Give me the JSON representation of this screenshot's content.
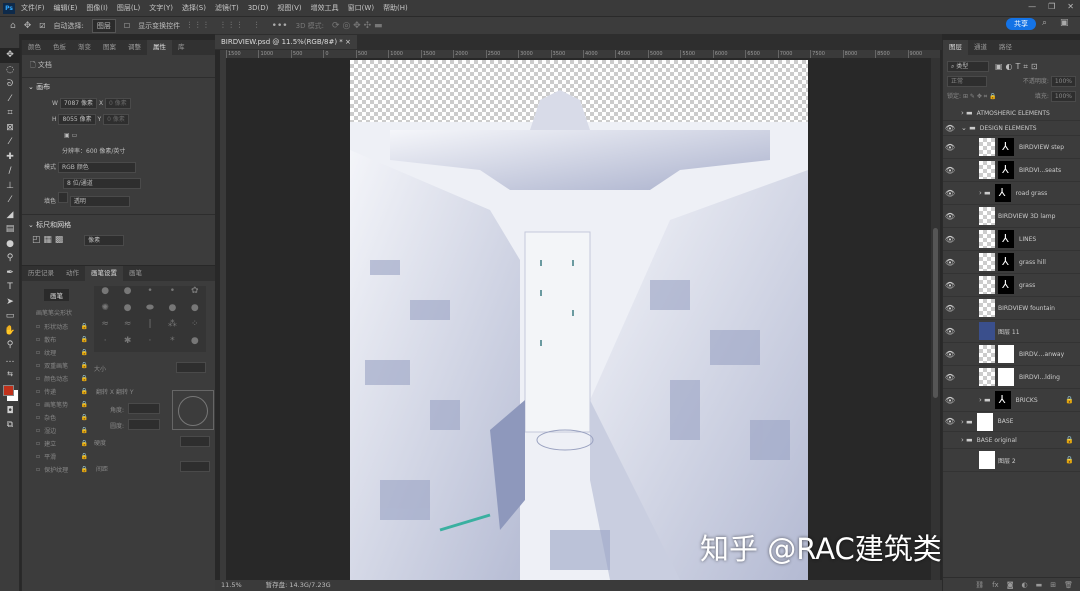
{
  "app": {
    "logo": "Ps"
  },
  "menu": [
    "文件(F)",
    "编辑(E)",
    "图像(I)",
    "图层(L)",
    "文字(Y)",
    "选择(S)",
    "滤镜(T)",
    "3D(D)",
    "视图(V)",
    "增效工具",
    "窗口(W)",
    "帮助(H)"
  ],
  "options": {
    "auto_select_label": "自动选择:",
    "auto_select_value": "图层",
    "show_transform_label": "显示变换控件",
    "mode_3d": "3D 模式:",
    "share": "共享"
  },
  "left_panel": {
    "tabs": [
      "颜色",
      "色板",
      "渐变",
      "图案",
      "调整",
      "属性",
      "库"
    ],
    "active_tab": "属性",
    "doc_label": "文档",
    "canvas_section": "画布",
    "w_label": "W",
    "w_value": "7087 像素",
    "x_label": "X",
    "h_label": "H",
    "h_value": "8055 像素",
    "y_label": "Y",
    "xy_placeholder": "0 像素",
    "resolution": "分辨率：600 像素/英寸",
    "mode_label": "模式",
    "mode_value": "RGB 颜色",
    "depth_value": "8 位/通道",
    "fill_label": "填色",
    "fill_value": "透明",
    "rulers_section": "标尺和网格",
    "grid_unit": "像素"
  },
  "brush_panel": {
    "tabs": [
      "历史记录",
      "动作",
      "画笔设置",
      "画笔"
    ],
    "active_tab": "画笔设置",
    "preset_button": "画笔",
    "tip_shape": "画笔笔尖形状",
    "options": [
      "形状动态",
      "散布",
      "纹理",
      "双重画笔",
      "颜色动态",
      "传递",
      "画笔笔势",
      "杂色",
      "湿边",
      "建立",
      "平滑",
      "保护纹理"
    ],
    "size_label": "大小",
    "flip_x": "翻转 X",
    "flip_y": "翻转 Y",
    "angle_label": "角度:",
    "roundness_label": "圆度:",
    "hardness_label": "硬度",
    "spacing_label": "间距"
  },
  "document": {
    "tab_title": "BIRDVIEW.psd @ 11.5%(RGB/8#) *",
    "ruler_ticks": [
      "1500",
      "1000",
      "500",
      "0",
      "500",
      "1000",
      "1500",
      "2000",
      "2500",
      "3000",
      "3500",
      "4000",
      "4500",
      "5000",
      "5500",
      "6000",
      "6500",
      "7000",
      "7500",
      "8000",
      "8500",
      "9000"
    ],
    "zoom": "11.5%",
    "scratch": "暂存盘: 14.3G/7.23G"
  },
  "watermark": "知乎 @RAC建筑类作品集",
  "layers_panel": {
    "tabs": [
      "图层",
      "通道",
      "路径"
    ],
    "active_tab": "图层",
    "filter": "类型",
    "blend": "正常",
    "opacity_label": "不透明度:",
    "opacity": "100%",
    "lock_label": "锁定:",
    "fill_label": "填充:",
    "fill": "100%",
    "layers": [
      {
        "name": "ATMOSHERIC ELEMENTS",
        "type": "group",
        "visible": false,
        "indent": 0
      },
      {
        "name": "DESIGN ELEMENTS",
        "type": "group",
        "visible": true,
        "indent": 0,
        "open": true
      },
      {
        "name": "BIRDVIEW step",
        "type": "smart",
        "visible": true,
        "mask": "black"
      },
      {
        "name": "BIRDVI...seats",
        "type": "smart",
        "visible": true,
        "mask": "black"
      },
      {
        "name": "road grass",
        "type": "subgroup",
        "visible": true,
        "mask": "black"
      },
      {
        "name": "BIRDVIEW 3D lamp",
        "type": "plain",
        "visible": true
      },
      {
        "name": "LINES",
        "type": "plain",
        "visible": true,
        "mask": "black"
      },
      {
        "name": "grass hill",
        "type": "plain",
        "visible": true,
        "mask": "black"
      },
      {
        "name": "grass",
        "type": "plain",
        "visible": true,
        "mask": "black"
      },
      {
        "name": "BIRDVIEW fountain",
        "type": "smart",
        "visible": true
      },
      {
        "name": "图层 11",
        "type": "fill",
        "visible": true,
        "color": "#3a4f8c"
      },
      {
        "name": "BIRDV....anway",
        "type": "smart",
        "visible": true,
        "mask": "white"
      },
      {
        "name": "BIRDVI...lding",
        "type": "smart",
        "visible": true,
        "mask": "white"
      },
      {
        "name": "BRICKS",
        "type": "subgroup",
        "visible": true,
        "mask": "black",
        "locked": true
      },
      {
        "name": "BASE",
        "type": "group",
        "visible": true,
        "mask": "white",
        "compact": true
      },
      {
        "name": "BASE original",
        "type": "group",
        "visible": false,
        "locked": true,
        "compact": true
      },
      {
        "name": "图层 2",
        "type": "smart",
        "visible": false,
        "locked": true,
        "white": true
      }
    ]
  },
  "colors": {
    "foreground": "#c0311b",
    "background": "#ffffff",
    "accent": "#1473e6"
  }
}
